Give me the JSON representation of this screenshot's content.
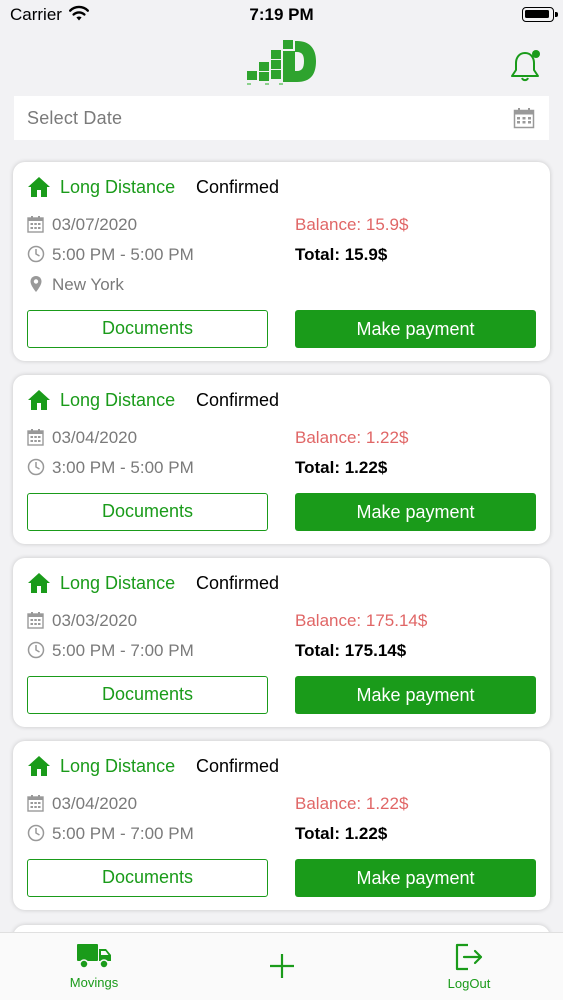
{
  "status_bar": {
    "carrier": "Carrier",
    "time": "7:19 PM"
  },
  "search": {
    "placeholder": "Select Date"
  },
  "colors": {
    "accent": "#1a9b1a",
    "balance": "#e06666",
    "muted": "#7a7a7a"
  },
  "bookings": [
    {
      "type": "Long Distance",
      "status": "Confirmed",
      "date": "03/07/2020",
      "time": "5:00 PM - 5:00 PM",
      "location": "New York",
      "balance": "Balance: 15.9$",
      "total": "Total: 15.9$",
      "documents_label": "Documents",
      "pay_label": "Make payment"
    },
    {
      "type": "Long Distance",
      "status": "Confirmed",
      "date": "03/04/2020",
      "time": "3:00 PM - 5:00 PM",
      "balance": "Balance: 1.22$",
      "total": "Total: 1.22$",
      "documents_label": "Documents",
      "pay_label": "Make payment"
    },
    {
      "type": "Long Distance",
      "status": "Confirmed",
      "date": "03/03/2020",
      "time": "5:00 PM - 7:00 PM",
      "balance": "Balance: 175.14$",
      "total": "Total: 175.14$",
      "documents_label": "Documents",
      "pay_label": "Make payment"
    },
    {
      "type": "Long Distance",
      "status": "Confirmed",
      "date": "03/04/2020",
      "time": "5:00 PM - 7:00 PM",
      "balance": "Balance: 1.22$",
      "total": "Total: 1.22$",
      "documents_label": "Documents",
      "pay_label": "Make payment"
    }
  ],
  "tab_bar": {
    "movings_label": "Movings",
    "add_icon": "plus-icon",
    "logout_label": "LogOut"
  }
}
